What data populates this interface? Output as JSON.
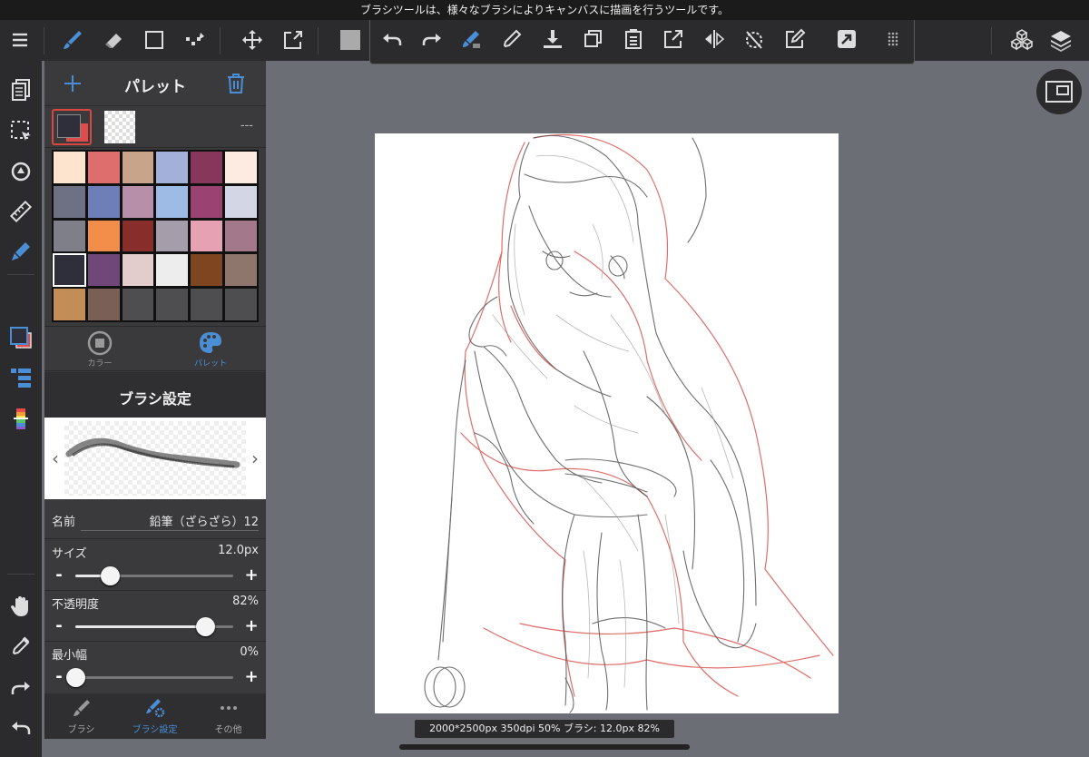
{
  "tooltip": "ブラシツールは、様々なブラシによりキャンバスに描画を行うツールです。",
  "palette": {
    "title": "パレット",
    "empty_label": "---",
    "colors": [
      "#fde4cf",
      "#de6e6e",
      "#c8a48a",
      "#a3b0d8",
      "#86375a",
      "#fdebe1",
      "#6d7183",
      "#6e7fb8",
      "#b88fa8",
      "#9ebbe6",
      "#9a4373",
      "#d3d7e5",
      "#7e7f88",
      "#f28e4a",
      "#872d2a",
      "#a59daa",
      "#e6a1b2",
      "#a3788b",
      "#2f2f3c",
      "#6f4778",
      "#e2cccc",
      "#ededed",
      "#7d4520",
      "#8e766d",
      "#c28d57",
      "#7a5f56",
      "#4e4e50",
      "#4e4e50",
      "#4e4e50",
      "#4e4e50"
    ],
    "selected_index": 18
  },
  "mode_tabs": [
    {
      "label": "カラー",
      "active": false
    },
    {
      "label": "パレット",
      "active": true
    }
  ],
  "brush": {
    "title": "ブラシ設定",
    "name_label": "名前",
    "name_value": "鉛筆（ざらざら）12",
    "size_label": "サイズ",
    "size_value": "12.0px",
    "size_level": 0.22,
    "opacity_label": "不透明度",
    "opacity_value": "82%",
    "opacity_level": 0.82,
    "min_label": "最小幅",
    "min_value": "0%",
    "min_level": 0.0,
    "minus": "-",
    "plus": "+"
  },
  "bottom_tabs": [
    {
      "label": "ブラシ",
      "active": false
    },
    {
      "label": "ブラシ設定",
      "active": true
    },
    {
      "label": "その他",
      "active": false
    }
  ],
  "status": "2000*2500px 350dpi 50% ブラシ: 12.0px 82%",
  "accent": "#4a8fd6",
  "icons": {
    "top_left": [
      "menu-icon",
      "brush-icon",
      "eraser-icon",
      "rectangle-icon",
      "selection-icon",
      "move-icon",
      "transform-icon",
      "color-icon"
    ],
    "command": [
      "undo-icon",
      "redo-icon",
      "fill-icon",
      "eyedropper-icon",
      "save-icon",
      "copy-icon",
      "paste-icon",
      "export-icon",
      "flip-icon",
      "rotate-icon",
      "edit-icon",
      "share-icon",
      "grid-icon"
    ],
    "top_right": [
      "materials-icon",
      "layers-icon"
    ]
  }
}
